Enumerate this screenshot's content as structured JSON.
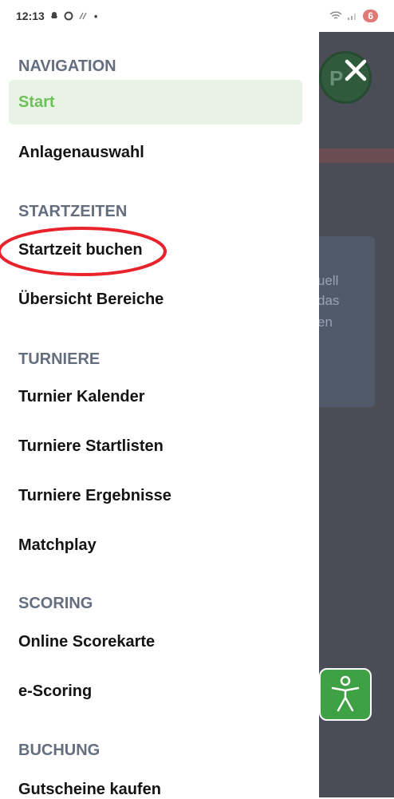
{
  "status_bar": {
    "time": "12:13",
    "battery": "6"
  },
  "drawer": {
    "sections": {
      "navigation": {
        "title": "NAVIGATION",
        "items": [
          "Start",
          "Anlagenauswahl"
        ]
      },
      "startzeiten": {
        "title": "STARTZEITEN",
        "items": [
          "Startzeit buchen",
          "Übersicht Bereiche"
        ]
      },
      "turniere": {
        "title": "TURNIERE",
        "items": [
          "Turnier Kalender",
          "Turniere Startlisten",
          "Turniere Ergebnisse",
          "Matchplay"
        ]
      },
      "scoring": {
        "title": "SCORING",
        "items": [
          "Online Scorekarte",
          "e-Scoring"
        ]
      },
      "buchung": {
        "title": "BUCHUNG",
        "items": [
          "Gutscheine kaufen"
        ]
      }
    },
    "active_item": "Start"
  },
  "background": {
    "avatar_initials": "P",
    "text_fragments": [
      "uell",
      "das",
      "en"
    ]
  },
  "colors": {
    "accent_green": "#6fbf5a",
    "active_bg": "#e8f3e6",
    "section_gray": "#656e7e",
    "overlay": "#4a4d55",
    "highlight_red": "#e8232b",
    "accessibility_green": "#3ea143"
  },
  "icons": {
    "close": "close-icon",
    "accessibility": "accessibility-icon"
  }
}
